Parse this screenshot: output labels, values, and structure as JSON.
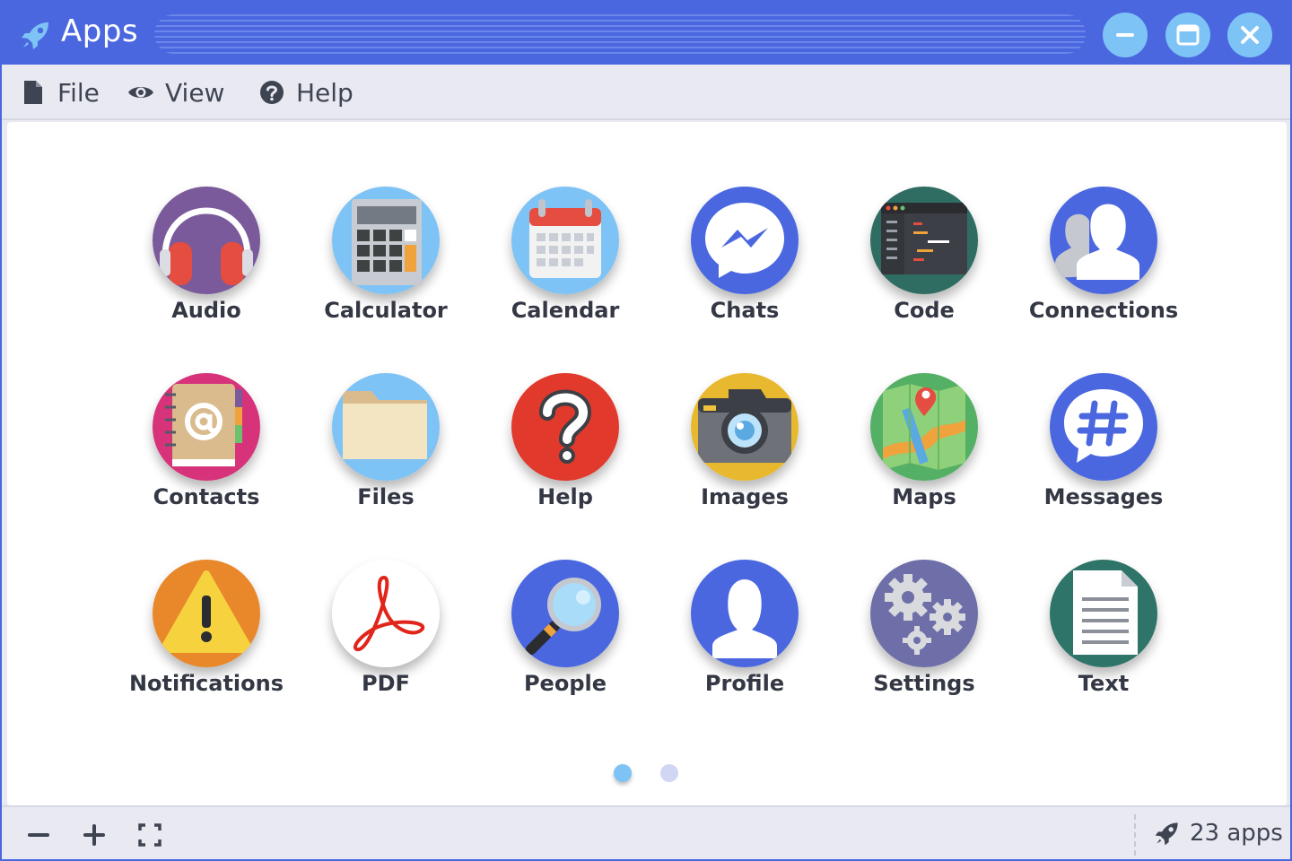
{
  "window": {
    "title": "Apps",
    "icon": "rocket-icon",
    "controls": [
      "minimize-icon",
      "maximize-icon",
      "close-icon"
    ]
  },
  "menu": {
    "file": {
      "label": "File",
      "icon": "file-icon"
    },
    "view": {
      "label": "View",
      "icon": "eye-icon"
    },
    "help": {
      "label": "Help",
      "icon": "question-circle-icon"
    }
  },
  "apps": [
    {
      "label": "Audio",
      "icon": "headphones-icon"
    },
    {
      "label": "Calculator",
      "icon": "calculator-icon"
    },
    {
      "label": "Calendar",
      "icon": "calendar-icon"
    },
    {
      "label": "Chats",
      "icon": "messenger-icon"
    },
    {
      "label": "Code",
      "icon": "code-editor-icon"
    },
    {
      "label": "Connections",
      "icon": "users-icon"
    },
    {
      "label": "Contacts",
      "icon": "address-book-icon"
    },
    {
      "label": "Files",
      "icon": "folder-icon"
    },
    {
      "label": "Help",
      "icon": "question-icon"
    },
    {
      "label": "Images",
      "icon": "camera-icon"
    },
    {
      "label": "Maps",
      "icon": "map-icon"
    },
    {
      "label": "Messages",
      "icon": "hashtag-bubble-icon"
    },
    {
      "label": "Notifications",
      "icon": "warning-icon"
    },
    {
      "label": "PDF",
      "icon": "pdf-icon"
    },
    {
      "label": "People",
      "icon": "magnifier-icon"
    },
    {
      "label": "Profile",
      "icon": "user-icon"
    },
    {
      "label": "Settings",
      "icon": "gears-icon"
    },
    {
      "label": "Text",
      "icon": "document-icon"
    }
  ],
  "pagination": {
    "pages": 2,
    "current": 1
  },
  "statusbar": {
    "zoom_out_icon": "minus-icon",
    "zoom_in_icon": "plus-icon",
    "fullscreen_icon": "fullscreen-icon",
    "count": "23 apps"
  },
  "colors": {
    "accent": "#4a67e0",
    "chrome": "#e9eaf1",
    "window_button": "#7ec3f5",
    "text": "#343844"
  }
}
